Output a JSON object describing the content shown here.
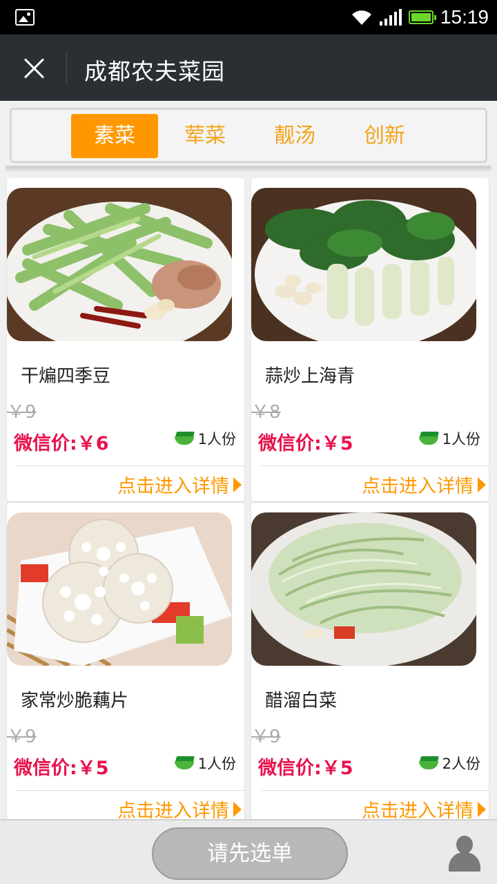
{
  "status_bar": {
    "time": "15:19"
  },
  "header": {
    "title": "成都农夫菜园"
  },
  "tabs": [
    {
      "label": "素菜",
      "active": true
    },
    {
      "label": "荤菜",
      "active": false
    },
    {
      "label": "靓汤",
      "active": false
    },
    {
      "label": "创新",
      "active": false
    }
  ],
  "dishes": [
    {
      "name": "干煸四季豆",
      "original_price": "￥9",
      "wechat_price": "微信价:￥6",
      "serving": "1人份",
      "detail_label": "点击进入详情",
      "image": "green-beans-with-pork-and-chili"
    },
    {
      "name": "蒜炒上海青",
      "original_price": "￥8",
      "wechat_price": "微信价:￥5",
      "serving": "1人份",
      "detail_label": "点击进入详情",
      "image": "bok-choy-with-garlic"
    },
    {
      "name": "家常炒脆藕片",
      "original_price": "￥9",
      "wechat_price": "微信价:￥5",
      "serving": "1人份",
      "detail_label": "点击进入详情",
      "image": "lotus-root-slices"
    },
    {
      "name": "醋溜白菜",
      "original_price": "￥9",
      "wechat_price": "微信价:￥5",
      "serving": "2人份",
      "detail_label": "点击进入详情",
      "image": "sliced-napa-cabbage"
    }
  ],
  "footer": {
    "order_button": "请先选单"
  },
  "colors": {
    "accent": "#ff9800",
    "price": "#e8124d",
    "header_bg": "#2b2f33"
  }
}
